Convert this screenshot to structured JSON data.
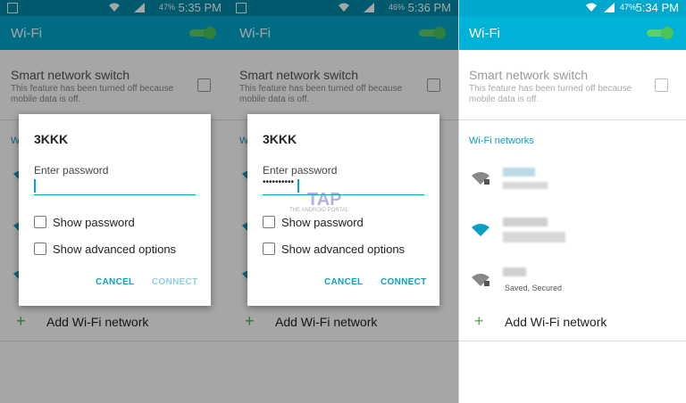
{
  "panels": [
    {
      "status": {
        "battery": "47%",
        "time": "5:35 PM"
      },
      "appbar": {
        "title": "Wi-Fi"
      },
      "smart_switch": {
        "title": "Smart network switch",
        "desc": "This feature has been turned off because mobile data is off."
      },
      "section_fragment": "Wi",
      "add_network": {
        "label": "Add Wi-Fi network"
      },
      "dialog": {
        "network": "3KKK",
        "password_label": "Enter password",
        "password_value": "",
        "show_password": "Show password",
        "advanced": "Show advanced options",
        "cancel": "CANCEL",
        "connect": "CONNECT"
      }
    },
    {
      "status": {
        "battery": "46%",
        "time": "5:36 PM"
      },
      "appbar": {
        "title": "Wi-Fi"
      },
      "smart_switch": {
        "title": "Smart network switch",
        "desc": "This feature has been turned off because mobile data is off."
      },
      "section_fragment": "Wi",
      "add_network": {
        "label": "Add Wi-Fi network"
      },
      "dialog": {
        "network": "3KKK",
        "password_label": "Enter password",
        "password_value": "••••••••••",
        "show_password": "Show password",
        "advanced": "Show advanced options",
        "cancel": "CANCEL",
        "connect": "CONNECT"
      },
      "watermark": {
        "logo": "TAP",
        "sub": "THE ANDROID PORTAL"
      }
    },
    {
      "status": {
        "battery": "47%",
        "time": "5:34 PM"
      },
      "appbar": {
        "title": "Wi-Fi"
      },
      "smart_switch": {
        "title": "Smart network switch",
        "desc": "This feature has been turned off because mobile data is off."
      },
      "section": "Wi-Fi networks",
      "network3_status": "Saved, Secured",
      "add_network": {
        "label": "Add Wi-Fi network"
      }
    }
  ],
  "colors": {
    "statusbar": "#008aa8",
    "appbar": "#00a8cd",
    "accent": "#0b9fc2",
    "toggle": "#4cc45a"
  },
  "icons": [
    "wifi-icon",
    "lock-icon",
    "signal-icon",
    "battery-icon",
    "plus-icon",
    "toggle-switch"
  ]
}
